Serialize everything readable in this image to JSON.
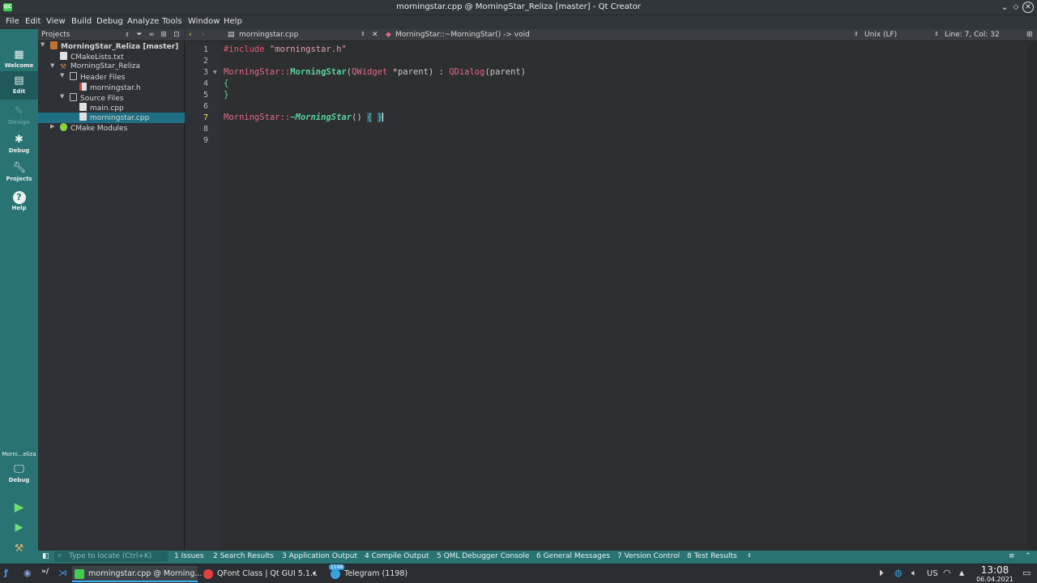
{
  "window": {
    "title": "morningstar.cpp @ MorningStar_Reliza [master] - Qt Creator",
    "app_icon": "QC"
  },
  "menu": [
    "File",
    "Edit",
    "View",
    "Build",
    "Debug",
    "Analyze",
    "Tools",
    "Window",
    "Help"
  ],
  "modes": {
    "welcome": "Welcome",
    "edit": "Edit",
    "design": "Design",
    "debug": "Debug",
    "projects": "Projects",
    "help": "Help",
    "kit_label": "Morni...eliza",
    "kit_mode": "Debug"
  },
  "projects_pane": {
    "label": "Projects",
    "tree": {
      "root": "MorningStar_Reliza [master]",
      "cmakelists": "CMakeLists.txt",
      "target": "MorningStar_Reliza",
      "header_files": "Header Files",
      "header_1": "morningstar.h",
      "source_files": "Source Files",
      "source_1": "main.cpp",
      "source_2": "morningstar.cpp",
      "cmake_modules": "CMake Modules"
    }
  },
  "editor": {
    "file_tab": "morningstar.cpp",
    "symbol": "MorningStar::~MorningStar() -> void",
    "line_ending": "Unix (LF)",
    "position": "Line: 7, Col: 32",
    "line_numbers": [
      "1",
      "2",
      "3",
      "4",
      "5",
      "6",
      "7",
      "8",
      "9"
    ],
    "code": {
      "l1_directive": "#include",
      "l1_string": "\"morningstar.h\"",
      "l3_class": "MorningStar",
      "l3_scope": "::",
      "l3_fn": "MorningStar",
      "l3_open": "(",
      "l3_type": "QWidget",
      "l3_param": " *parent) : ",
      "l3_base": "QDialog",
      "l3_args": "(parent)",
      "l4": "{",
      "l5": "}",
      "l7_class": "MorningStar",
      "l7_scope": "::",
      "l7_fn": "~MorningStar",
      "l7_parens": "() ",
      "l7_open": "{",
      "l7_close": "}"
    }
  },
  "output_bar": {
    "locator_placeholder": "Type to locate (Ctrl+K)",
    "tabs": [
      "1  Issues",
      "2  Search Results",
      "3  Application Output",
      "4  Compile Output",
      "5  QML Debugger Console",
      "6  General Messages",
      "7  Version Control",
      "8  Test Results"
    ]
  },
  "taskbar": {
    "tasks": [
      "morningstar.cpp @ Morning...",
      "QFont Class | Qt GUI 5.1...",
      "Telegram (1198)"
    ],
    "keyboard_layout": "US",
    "time": "13:08",
    "date": "06.04.2021",
    "badge": "1198"
  },
  "colors": {
    "accent": "#2a7373",
    "selection": "#1f6f84",
    "keyword": "#e06a8a",
    "function": "#5ad0a0"
  }
}
